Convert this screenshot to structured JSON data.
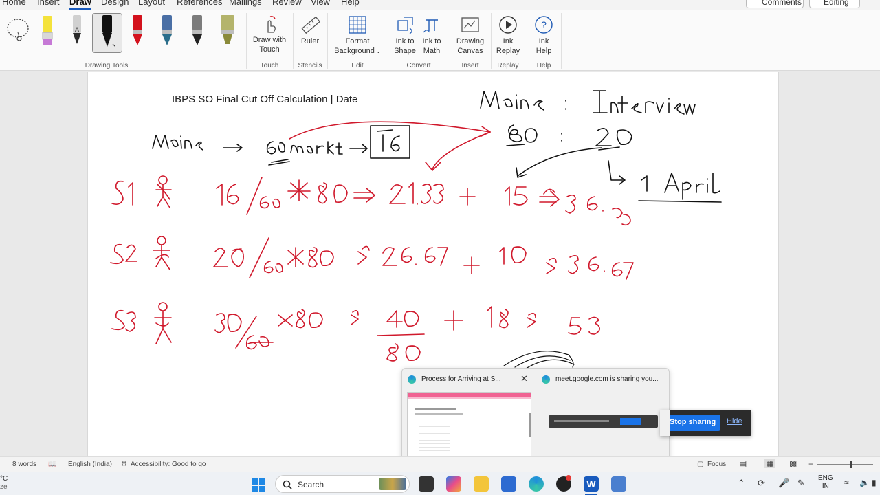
{
  "menu": {
    "tabs": [
      "Home",
      "Insert",
      "Draw",
      "Design",
      "Layout",
      "References",
      "Mailings",
      "Review",
      "View",
      "Help"
    ],
    "active_tab": "Draw",
    "comments_label": "Comments",
    "editing_label": "Editing"
  },
  "ribbon": {
    "groups": {
      "drawing_tools": "Drawing Tools",
      "touch": "Touch",
      "stencils": "Stencils",
      "edit": "Edit",
      "convert": "Convert",
      "insert": "Insert",
      "replay": "Replay",
      "help": "Help"
    },
    "buttons": {
      "draw_with_touch": [
        "Draw with",
        "Touch"
      ],
      "ruler": "Ruler",
      "format_background": [
        "Format",
        "Background"
      ],
      "ink_to_shape": [
        "Ink to",
        "Shape"
      ],
      "ink_to_math": [
        "Ink to",
        "Math"
      ],
      "drawing_canvas": [
        "Drawing",
        "Canvas"
      ],
      "ink_replay": [
        "Ink",
        "Replay"
      ],
      "ink_help": [
        "Ink",
        "Help"
      ]
    },
    "pen_colors": [
      "#1a1a1a",
      "#d3121d",
      "#2a6d8a",
      "#7c7c7c",
      "#8a8a3a"
    ],
    "highlighter_colors": [
      "#f4e23b",
      "#c679d6"
    ]
  },
  "document": {
    "title": "IBPS SO Final Cut Off Calculation | Date"
  },
  "status": {
    "words": "8 words",
    "language": "English (India)",
    "accessibility": "Accessibility: Good to go",
    "focus": "Focus"
  },
  "taskbar": {
    "search_placeholder": "Search",
    "lang_top": "ENG",
    "lang_bottom": "IN"
  },
  "thumbnails": {
    "left_title": "Process for Arriving at S...",
    "right_title": "meet.google.com is sharing you..."
  },
  "share_bar": {
    "stop_label": "Stop sharing",
    "hide_label": "Hide"
  },
  "colors": {
    "accent": "#185abd",
    "ink_red": "#d0182b",
    "ink_black": "#111111",
    "meet_blue": "#1a73e8"
  }
}
